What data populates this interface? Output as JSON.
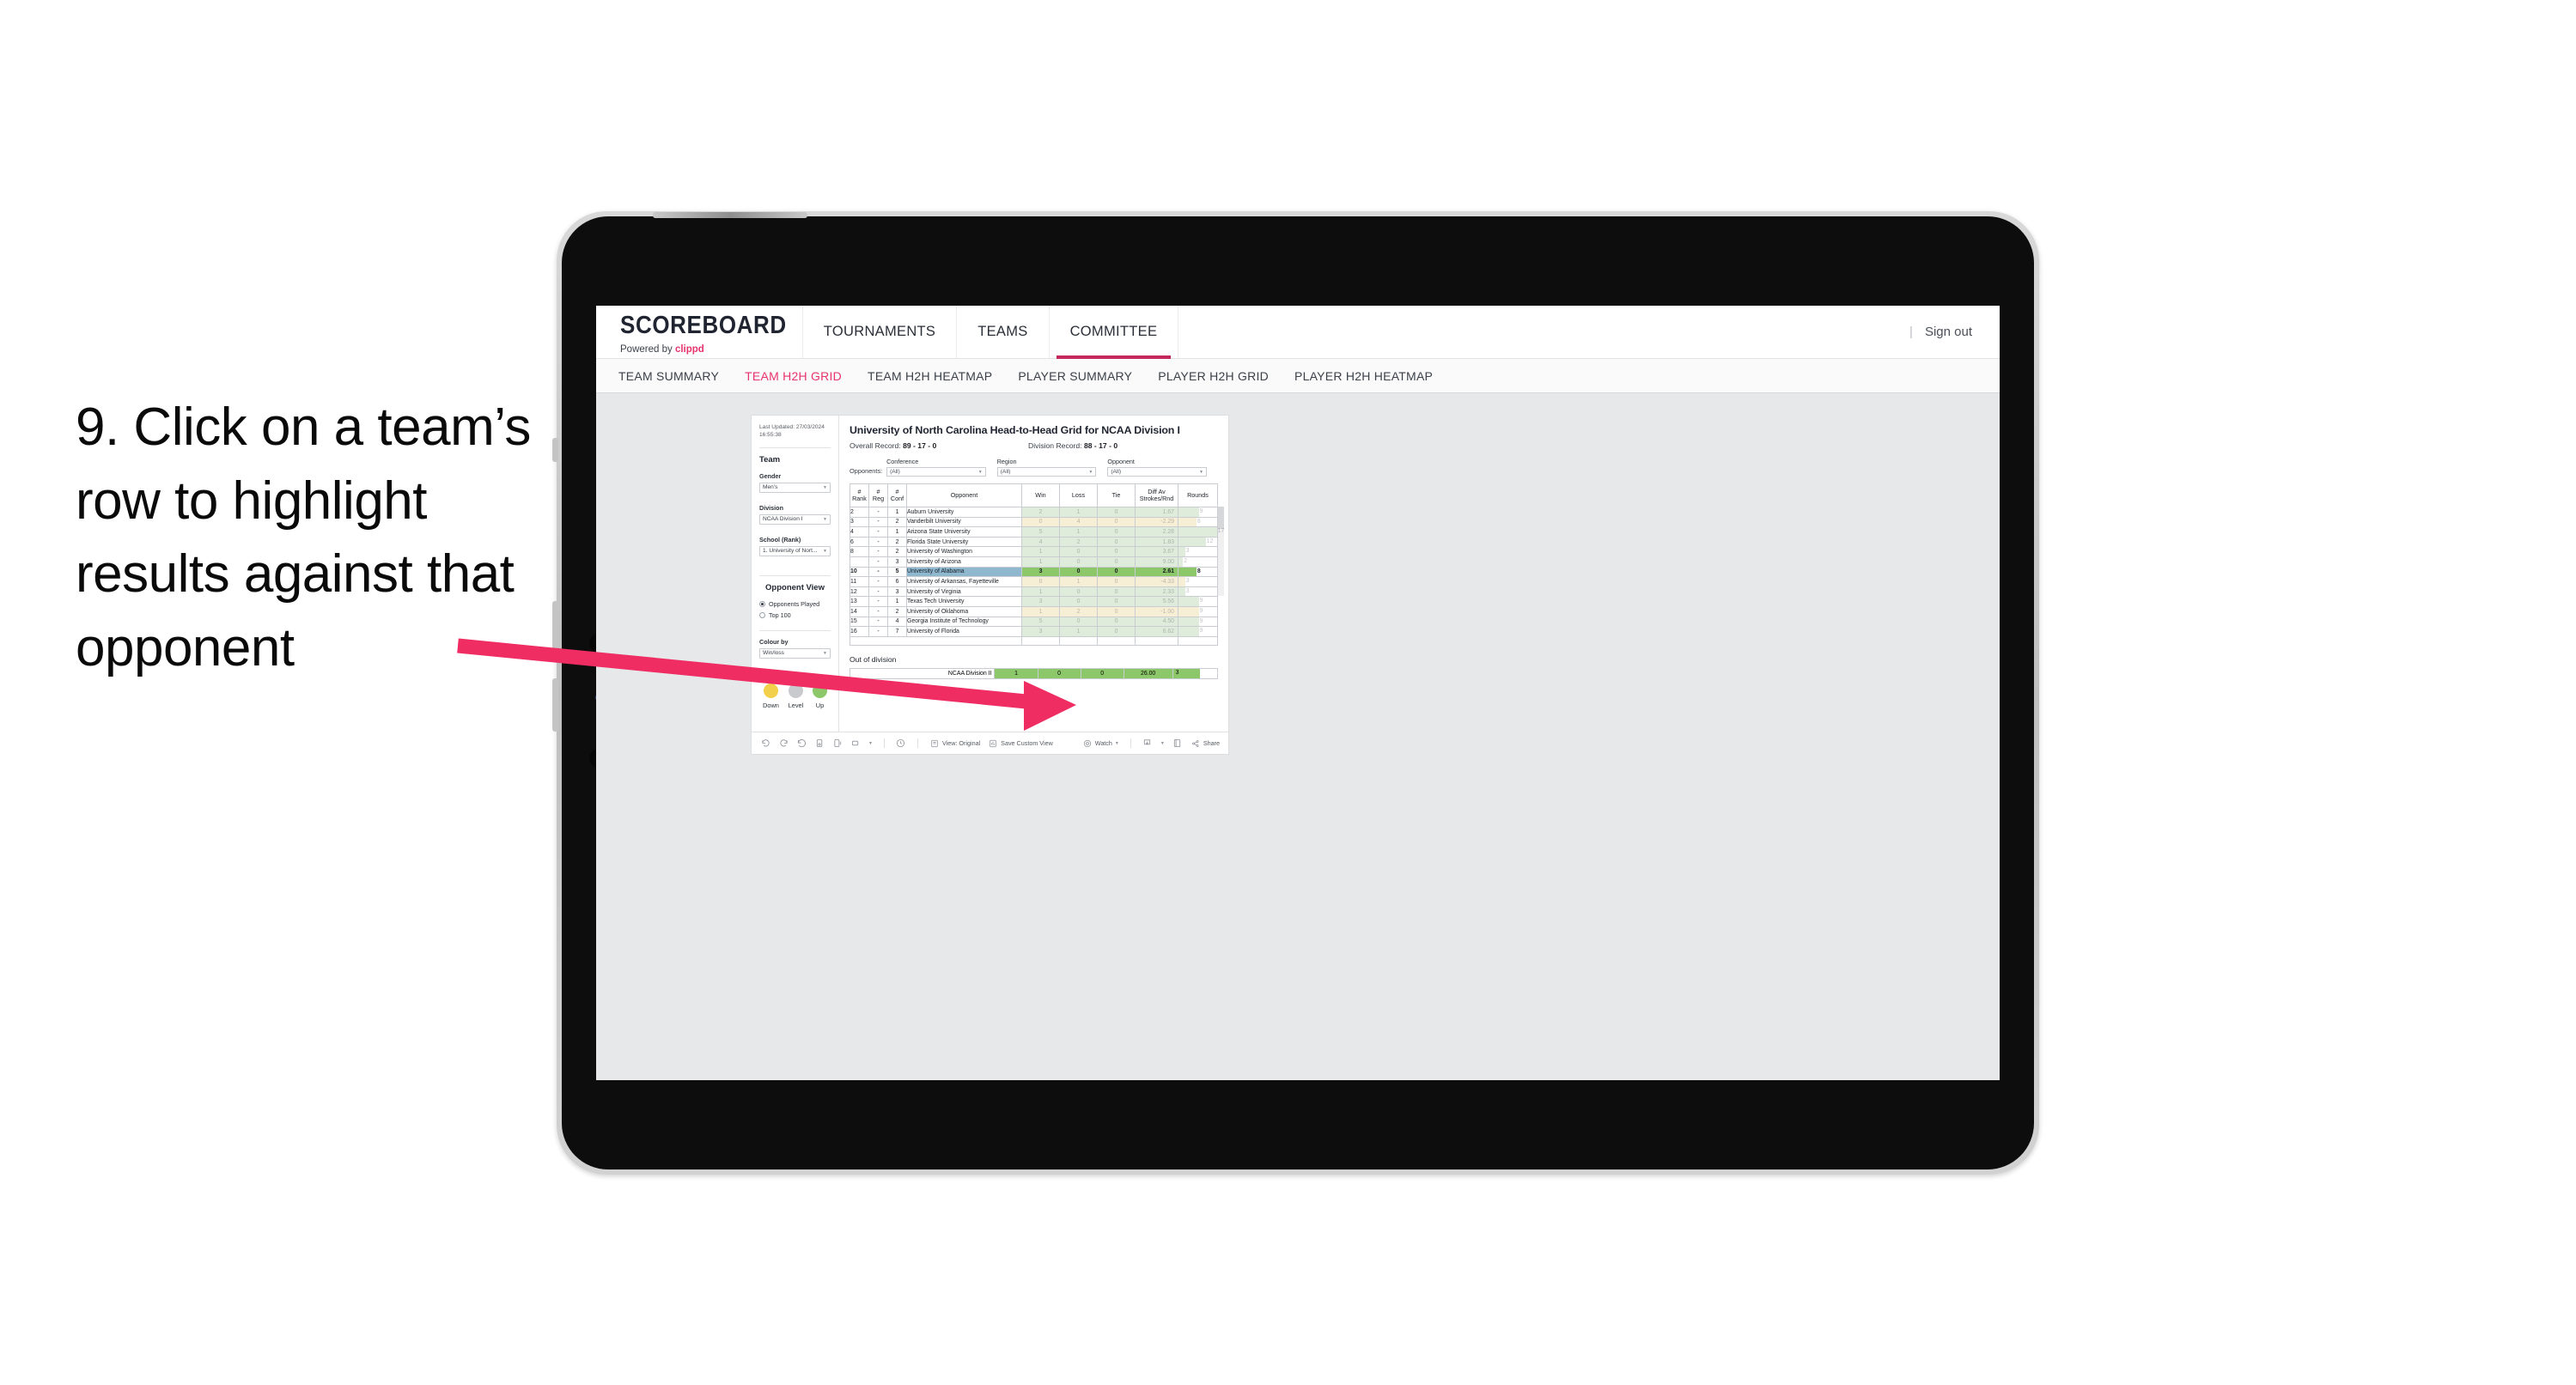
{
  "instruction": {
    "text": "9. Click on a team’s row to highlight results against that opponent"
  },
  "colors": {
    "accent_pink": "#e8336d",
    "tab_underline": "#c4275a",
    "arrow": "#ef2d63",
    "legend_down": "#f2d04b",
    "legend_level": "#c8cace",
    "legend_up": "#8cc86a",
    "row_selected": "#8fb8cf",
    "bar_green_strong": "#8cc86a"
  },
  "browser": {
    "brand": {
      "name": "SCOREBOARD",
      "sub_prefix": "Powered by ",
      "sub_brand": "clippd"
    },
    "top_nav": [
      {
        "label": "TOURNAMENTS",
        "active": false
      },
      {
        "label": "TEAMS",
        "active": false
      },
      {
        "label": "COMMITTEE",
        "active": true
      }
    ],
    "right": {
      "divider": "|",
      "sign_out": "Sign out"
    },
    "sub_nav": [
      {
        "label": "TEAM SUMMARY",
        "active": false
      },
      {
        "label": "TEAM H2H GRID",
        "active": true
      },
      {
        "label": "TEAM H2H HEATMAP",
        "active": false
      },
      {
        "label": "PLAYER SUMMARY",
        "active": false
      },
      {
        "label": "PLAYER H2H GRID",
        "active": false
      },
      {
        "label": "PLAYER H2H HEATMAP",
        "active": false
      }
    ]
  },
  "sidebar": {
    "last_updated": "Last Updated: 27/03/2024 16:55:38",
    "team_heading": "Team",
    "gender": {
      "label": "Gender",
      "value": "Men’s"
    },
    "division": {
      "label": "Division",
      "value": "NCAA Division I"
    },
    "school": {
      "label": "School (Rank)",
      "value": "1. University of Nort..."
    },
    "opponent_view": {
      "heading": "Opponent View",
      "options": [
        {
          "label": "Opponents Played",
          "selected": true
        },
        {
          "label": "Top 100",
          "selected": false
        }
      ]
    },
    "colour_by": {
      "label": "Colour by",
      "value": "Win/loss"
    },
    "legend": [
      {
        "label": "Down",
        "color": "#f2d04b"
      },
      {
        "label": "Level",
        "color": "#c8cace"
      },
      {
        "label": "Up",
        "color": "#8cc86a"
      }
    ]
  },
  "report": {
    "title": "University of North Carolina Head-to-Head Grid for NCAA Division I",
    "overall_record": {
      "label": "Overall Record: ",
      "value": "89 - 17 - 0"
    },
    "division_record": {
      "label": "Division Record: ",
      "value": "88 - 17 - 0"
    },
    "opponents_label": "Opponents:",
    "filters": [
      {
        "label": "Conference",
        "value": "(All)"
      },
      {
        "label": "Region",
        "value": "(All)"
      },
      {
        "label": "Opponent",
        "value": "(All)"
      }
    ],
    "table": {
      "headers": [
        "# Rank",
        "# Reg",
        "# Conf",
        "Opponent",
        "Win",
        "Loss",
        "Tie",
        "Diff Av Strokes/Rnd",
        "Rounds"
      ],
      "header_lines": [
        [
          "#",
          "Rank"
        ],
        [
          "#",
          "Reg"
        ],
        [
          "#",
          "Conf"
        ],
        [
          "Opponent"
        ],
        [
          "Win"
        ],
        [
          "Loss"
        ],
        [
          "Tie"
        ],
        [
          "Diff Av",
          "Strokes/Rnd"
        ],
        [
          "Rounds"
        ]
      ],
      "rows": [
        {
          "rank": "2",
          "reg": "-",
          "conf": "1",
          "opponent": "Auburn University",
          "win": "2",
          "loss": "1",
          "tie": "0",
          "diff": "1.67",
          "rounds": "9",
          "tone": "up",
          "selected": false
        },
        {
          "rank": "3",
          "reg": "-",
          "conf": "2",
          "opponent": "Vanderbilt University",
          "win": "0",
          "loss": "4",
          "tie": "0",
          "diff": "-2.29",
          "rounds": "8",
          "tone": "down",
          "selected": false
        },
        {
          "rank": "4",
          "reg": "-",
          "conf": "1",
          "opponent": "Arizona State University",
          "win": "5",
          "loss": "1",
          "tie": "0",
          "diff": "2.28",
          "rounds": "17",
          "tone": "up",
          "selected": false
        },
        {
          "rank": "6",
          "reg": "-",
          "conf": "2",
          "opponent": "Florida State University",
          "win": "4",
          "loss": "2",
          "tie": "0",
          "diff": "1.83",
          "rounds": "12",
          "tone": "up",
          "selected": false
        },
        {
          "rank": "8",
          "reg": "-",
          "conf": "2",
          "opponent": "University of Washington",
          "win": "1",
          "loss": "0",
          "tie": "0",
          "diff": "3.67",
          "rounds": "3",
          "tone": "up",
          "selected": false
        },
        {
          "rank": "",
          "reg": "-",
          "conf": "3",
          "opponent": "University of Arizona",
          "win": "1",
          "loss": "0",
          "tie": "0",
          "diff": "9.00",
          "rounds": "2",
          "tone": "up",
          "selected": false
        },
        {
          "rank": "10",
          "reg": "-",
          "conf": "5",
          "opponent": "University of Alabama",
          "win": "3",
          "loss": "0",
          "tie": "0",
          "diff": "2.61",
          "rounds": "8",
          "tone": "up",
          "selected": true
        },
        {
          "rank": "11",
          "reg": "-",
          "conf": "6",
          "opponent": "University of Arkansas, Fayetteville",
          "win": "0",
          "loss": "1",
          "tie": "0",
          "diff": "-4.33",
          "rounds": "3",
          "tone": "down",
          "selected": false
        },
        {
          "rank": "12",
          "reg": "-",
          "conf": "3",
          "opponent": "University of Virginia",
          "win": "1",
          "loss": "0",
          "tie": "0",
          "diff": "2.33",
          "rounds": "3",
          "tone": "up",
          "selected": false
        },
        {
          "rank": "13",
          "reg": "-",
          "conf": "1",
          "opponent": "Texas Tech University",
          "win": "3",
          "loss": "0",
          "tie": "0",
          "diff": "5.56",
          "rounds": "9",
          "tone": "up",
          "selected": false
        },
        {
          "rank": "14",
          "reg": "-",
          "conf": "2",
          "opponent": "University of Oklahoma",
          "win": "1",
          "loss": "2",
          "tie": "0",
          "diff": "-1.00",
          "rounds": "9",
          "tone": "down",
          "selected": false
        },
        {
          "rank": "15",
          "reg": "-",
          "conf": "4",
          "opponent": "Georgia Institute of Technology",
          "win": "5",
          "loss": "0",
          "tie": "0",
          "diff": "4.50",
          "rounds": "9",
          "tone": "up",
          "selected": false
        },
        {
          "rank": "16",
          "reg": "-",
          "conf": "7",
          "opponent": "University of Florida",
          "win": "3",
          "loss": "1",
          "tie": "0",
          "diff": "6.62",
          "rounds": "9",
          "tone": "up",
          "selected": false
        }
      ]
    },
    "out_of_division": {
      "title": "Out of division",
      "row": {
        "label": "NCAA Division II",
        "win": "1",
        "loss": "0",
        "tie": "0",
        "diff": "26.00",
        "rounds": "3"
      }
    }
  },
  "toolbar": {
    "view_label": "View: Original",
    "save_label": "Save Custom View",
    "watch_label": "Watch",
    "share_label": "Share"
  },
  "chart_data": {
    "type": "table",
    "title": "University of North Carolina Head-to-Head Grid for NCAA Division I",
    "columns": [
      "# Rank",
      "# Reg",
      "# Conf",
      "Opponent",
      "Win",
      "Loss",
      "Tie",
      "Diff Av Strokes/Rnd",
      "Rounds"
    ],
    "rows": [
      [
        "2",
        "-",
        "1",
        "Auburn University",
        2,
        1,
        0,
        1.67,
        9
      ],
      [
        "3",
        "-",
        "2",
        "Vanderbilt University",
        0,
        4,
        0,
        -2.29,
        8
      ],
      [
        "4",
        "-",
        "1",
        "Arizona State University",
        5,
        1,
        0,
        2.28,
        17
      ],
      [
        "6",
        "-",
        "2",
        "Florida State University",
        4,
        2,
        0,
        1.83,
        12
      ],
      [
        "8",
        "-",
        "2",
        "University of Washington",
        1,
        0,
        0,
        3.67,
        3
      ],
      [
        "",
        "-",
        "3",
        "University of Arizona",
        1,
        0,
        0,
        9.0,
        2
      ],
      [
        "10",
        "-",
        "5",
        "University of Alabama",
        3,
        0,
        0,
        2.61,
        8
      ],
      [
        "11",
        "-",
        "6",
        "University of Arkansas, Fayetteville",
        0,
        1,
        0,
        -4.33,
        3
      ],
      [
        "12",
        "-",
        "3",
        "University of Virginia",
        1,
        0,
        0,
        2.33,
        3
      ],
      [
        "13",
        "-",
        "1",
        "Texas Tech University",
        3,
        0,
        0,
        5.56,
        9
      ],
      [
        "14",
        "-",
        "2",
        "University of Oklahoma",
        1,
        2,
        0,
        -1.0,
        9
      ],
      [
        "15",
        "-",
        "4",
        "Georgia Institute of Technology",
        5,
        0,
        0,
        4.5,
        9
      ],
      [
        "16",
        "-",
        "7",
        "University of Florida",
        3,
        1,
        0,
        6.62,
        9
      ]
    ],
    "out_of_division": [
      [
        "NCAA Division II",
        1,
        0,
        0,
        26.0,
        3
      ]
    ],
    "selected_row_index": 6,
    "rounds_max": 17,
    "legend": [
      {
        "label": "Down",
        "color": "#f2d04b"
      },
      {
        "label": "Level",
        "color": "#c8cace"
      },
      {
        "label": "Up",
        "color": "#8cc86a"
      }
    ]
  }
}
